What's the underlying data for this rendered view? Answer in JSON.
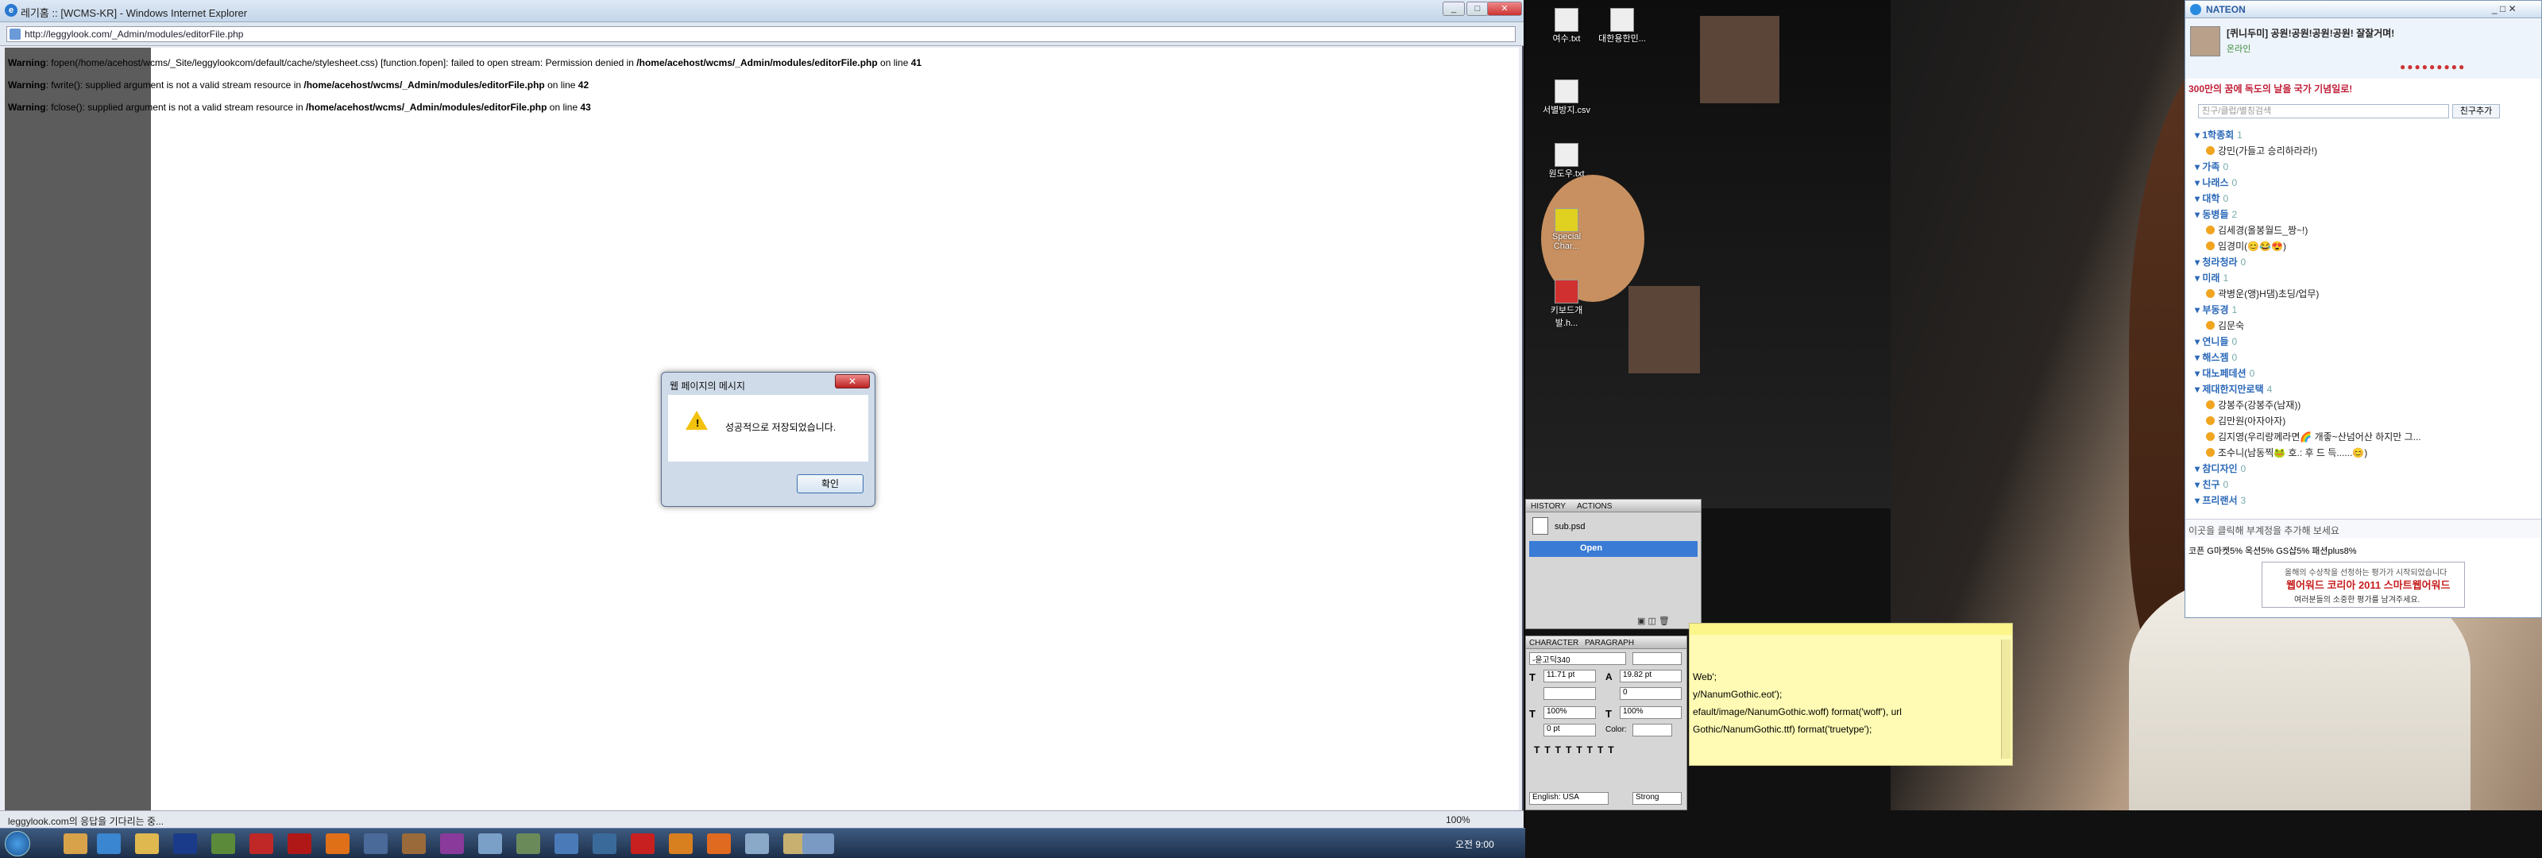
{
  "ie": {
    "title": "레기홈 :: [WCMS-KR] - Windows Internet Explorer",
    "url": "http://leggylook.com/_Admin/modules/editorFile.php",
    "status": "leggylook.com의 응답을 기다리는 중...",
    "zoom": "100%",
    "warnings": [
      {
        "label": "Warning",
        "text": ": fopen(/home/acehost/wcms/_Site/leggylookcom/default/cache/stylesheet.css) [function.fopen]: failed to open stream: Permission denied in ",
        "path": "/home/acehost/wcms/_Admin/modules/editorFile.php",
        "on": " on line ",
        "line": "41"
      },
      {
        "label": "Warning",
        "text": ": fwrite(): supplied argument is not a valid stream resource in ",
        "path": "/home/acehost/wcms/_Admin/modules/editorFile.php",
        "on": " on line ",
        "line": "42"
      },
      {
        "label": "Warning",
        "text": ": fclose(): supplied argument is not a valid stream resource in ",
        "path": "/home/acehost/wcms/_Admin/modules/editorFile.php",
        "on": " on line ",
        "line": "43"
      }
    ]
  },
  "dialog": {
    "title": "웹 페이지의 메시지",
    "message": "성공적으로 저장되었습니다.",
    "ok": "확인",
    "icon_mark": "!"
  },
  "taskbar": {
    "clock": "오전 9:00"
  },
  "desktop": {
    "icons": [
      {
        "label": "여수.txt"
      },
      {
        "label": "대한용한민..."
      },
      {
        "label": "서별방지.csv"
      },
      {
        "label": "원도우.txt"
      },
      {
        "label": "Special Char..."
      },
      {
        "label": "키보드개발.h..."
      }
    ]
  },
  "photoshop": {
    "history_tab": "HISTORY",
    "actions_tab": "ACTIONS",
    "history_file": "sub.psd",
    "history_open": "Open",
    "character_tab": "CHARACTER",
    "paragraph_tab": "PARAGRAPH",
    "font": "-윤고딕340",
    "size": "11.71 pt",
    "leading": "19.82 pt",
    "tracking": "0",
    "scale_v": "100%",
    "scale_h": "100%",
    "baseline": "0 pt",
    "color_label": "Color:",
    "language": "English: USA",
    "antialias": "Strong"
  },
  "sticky": {
    "lines": [
      "Web';",
      "y/NanumGothic.eot');",
      "efault/image/NanumGothic.woff) format('woff'), url",
      "Gothic/NanumGothic.ttf) format('truetype');"
    ]
  },
  "nateon": {
    "app_title": "NATEON",
    "profile_name": "[퀴니두미] 공원!공원!공원!공원! 잘잘거며!",
    "profile_status": "온라인",
    "notice": "300만의 꿈에 독도의 날을 국가 기념일로!",
    "search_placeholder": "친구/클럽/별칭검색",
    "add_friend": "친구추가",
    "groups": [
      {
        "name": "1학종회",
        "count": "1",
        "friends": [
          "강민(가들고 승리하라라!)"
        ]
      },
      {
        "name": "가족",
        "count": "0",
        "friends": []
      },
      {
        "name": "나래스",
        "count": "0",
        "friends": []
      },
      {
        "name": "대학",
        "count": "0",
        "friends": []
      },
      {
        "name": "동병들",
        "count": "2",
        "friends": [
          "김세경(올봉월드_짱~!)",
          "임경미(😊😂😍)"
        ]
      },
      {
        "name": "청라청라",
        "count": "0",
        "friends": []
      },
      {
        "name": "미래",
        "count": "1",
        "friends": [
          "곽병운(앵}H댐)초딩/업무)"
        ]
      },
      {
        "name": "부동경",
        "count": "1",
        "friends": [
          "김문숙"
        ]
      },
      {
        "name": "연니들",
        "count": "0",
        "friends": []
      },
      {
        "name": "해스젬",
        "count": "0",
        "friends": []
      },
      {
        "name": "대노페데션",
        "count": "0",
        "friends": []
      },
      {
        "name": "제대한지만로택",
        "count": "4",
        "friends": [
          "강봉주(강봉주(남재))",
          "김만원(아자아자)",
          "김지영(우리랑께라면🌈 개좋~산넘어산 하지만 그...",
          "조수니(남동찍🐸 호.: 후 드 득......😊)"
        ]
      },
      {
        "name": "참디자인",
        "count": "0",
        "friends": []
      },
      {
        "name": "친구",
        "count": "0",
        "friends": []
      },
      {
        "name": "프리랜서",
        "count": "3",
        "friends": []
      }
    ],
    "memo": "이곳을 클릭해 부계정을 추가해 보세요",
    "ticker": "코픈  G마켓5%  옥션5%  GS샵5%  패션plus8%",
    "ad_line1": "올해의 수상작을 선정하는 평가가 시작되었습니다",
    "ad_line2": "웹어워드 코리아 2011 스마트웹어워드",
    "ad_line3": "여러분들의 소중한 평가를 남겨주세요."
  }
}
